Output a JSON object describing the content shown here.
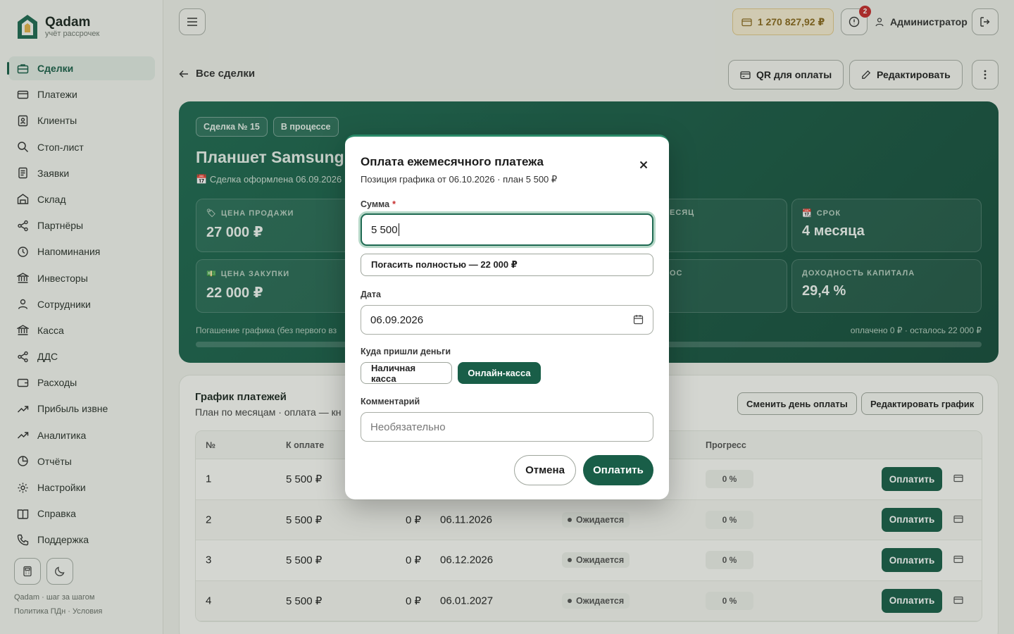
{
  "brand": {
    "name": "Qadam",
    "tagline": "учёт рассрочек"
  },
  "sidebar": {
    "items": [
      {
        "label": "Сделки",
        "icon": "briefcase-icon",
        "active": true
      },
      {
        "label": "Платежи",
        "icon": "card-icon"
      },
      {
        "label": "Клиенты",
        "icon": "contact-icon"
      },
      {
        "label": "Стоп-лист",
        "icon": "search-icon"
      },
      {
        "label": "Заявки",
        "icon": "document-icon"
      },
      {
        "label": "Склад",
        "icon": "warehouse-icon"
      },
      {
        "label": "Партнёры",
        "icon": "share-icon"
      },
      {
        "label": "Напоминания",
        "icon": "clock-icon"
      },
      {
        "label": "Инвесторы",
        "icon": "bank-icon"
      },
      {
        "label": "Сотрудники",
        "icon": "user-icon"
      },
      {
        "label": "Касса",
        "icon": "bank-icon"
      },
      {
        "label": "ДДС",
        "icon": "share-icon"
      },
      {
        "label": "Расходы",
        "icon": "wallet-icon"
      },
      {
        "label": "Прибыль извне",
        "icon": "trend-icon"
      },
      {
        "label": "Аналитика",
        "icon": "trend-icon"
      },
      {
        "label": "Отчёты",
        "icon": "pie-icon"
      },
      {
        "label": "Настройки",
        "icon": "gear-icon"
      },
      {
        "label": "Справка",
        "icon": "book-icon"
      },
      {
        "label": "Поддержка",
        "icon": "phone-icon"
      }
    ],
    "footer": {
      "line1": "Qadam · шаг за шагом",
      "line2": "Политика ПДн · Условия"
    }
  },
  "topbar": {
    "balance": "1 270 827,92 ₽",
    "alerts_count": "2",
    "user": "Администратор"
  },
  "page": {
    "back_label": "Все сделки",
    "qr_button": "QR для оплаты",
    "edit_button": "Редактировать"
  },
  "deal": {
    "number_chip": "Сделка № 15",
    "status_chip": "В процессе",
    "title": "Планшет Samsung",
    "created": "Сделка оформлена 06.09.2026",
    "stats": {
      "sale_price_label": "ЦЕНА ПРОДАЖИ",
      "sale_price": "27 000 ₽",
      "month_label": "ЕСЯЦ",
      "term_label": "СРОК",
      "term": "4 месяца",
      "purchase_label": "ЦЕНА ЗАКУПКИ",
      "purchase": "22 000 ₽",
      "mid2_label": "ОС",
      "roi_label": "ДОХОДНОСТЬ КАПИТАЛА",
      "roi": "29,4 %"
    },
    "progress_caption": "Погашение графика (без первого вз",
    "progress_summary": "оплачено 0 ₽ · осталось 22 000 ₽",
    "progress_fraction": 0
  },
  "schedule": {
    "title": "График платежей",
    "subtitle": "План по месяцам · оплата — кн",
    "change_day_button": "Сменить день оплаты",
    "edit_schedule_button": "Редактировать график",
    "columns": {
      "num": "№",
      "due": "К оплате",
      "progress": "Прогресс"
    },
    "rows": [
      {
        "num": "1",
        "due": "5 500 ₽",
        "paid": "",
        "date": "",
        "status": "",
        "progress": "0 %",
        "action": "Оплатить"
      },
      {
        "num": "2",
        "due": "5 500 ₽",
        "paid": "0 ₽",
        "date": "06.11.2026",
        "status": "Ожидается",
        "progress": "0 %",
        "action": "Оплатить"
      },
      {
        "num": "3",
        "due": "5 500 ₽",
        "paid": "0 ₽",
        "date": "06.12.2026",
        "status": "Ожидается",
        "progress": "0 %",
        "action": "Оплатить"
      },
      {
        "num": "4",
        "due": "5 500 ₽",
        "paid": "0 ₽",
        "date": "06.01.2027",
        "status": "Ожидается",
        "progress": "0 %",
        "action": "Оплатить"
      }
    ]
  },
  "modal": {
    "title": "Оплата ежемесячного платежа",
    "subtitle": "Позиция графика от 06.10.2026 · план 5 500 ₽",
    "amount_label": "Сумма",
    "amount_required": "*",
    "amount_value": "5 500",
    "payoff_button": "Погасить полностью — 22 000 ₽",
    "date_label": "Дата",
    "date_value": "06.09.2026",
    "destination_label": "Куда пришли деньги",
    "destination_options": [
      "Наличная касса",
      "Онлайн-касса"
    ],
    "destination_selected": "Онлайн-касса",
    "comment_label": "Комментарий",
    "comment_placeholder": "Необязательно",
    "cancel_button": "Отмена",
    "pay_button": "Оплатить"
  },
  "colors": {
    "accent": "#195e48",
    "alert": "#c62d2d",
    "balance_bg": "#f6ecd1"
  }
}
